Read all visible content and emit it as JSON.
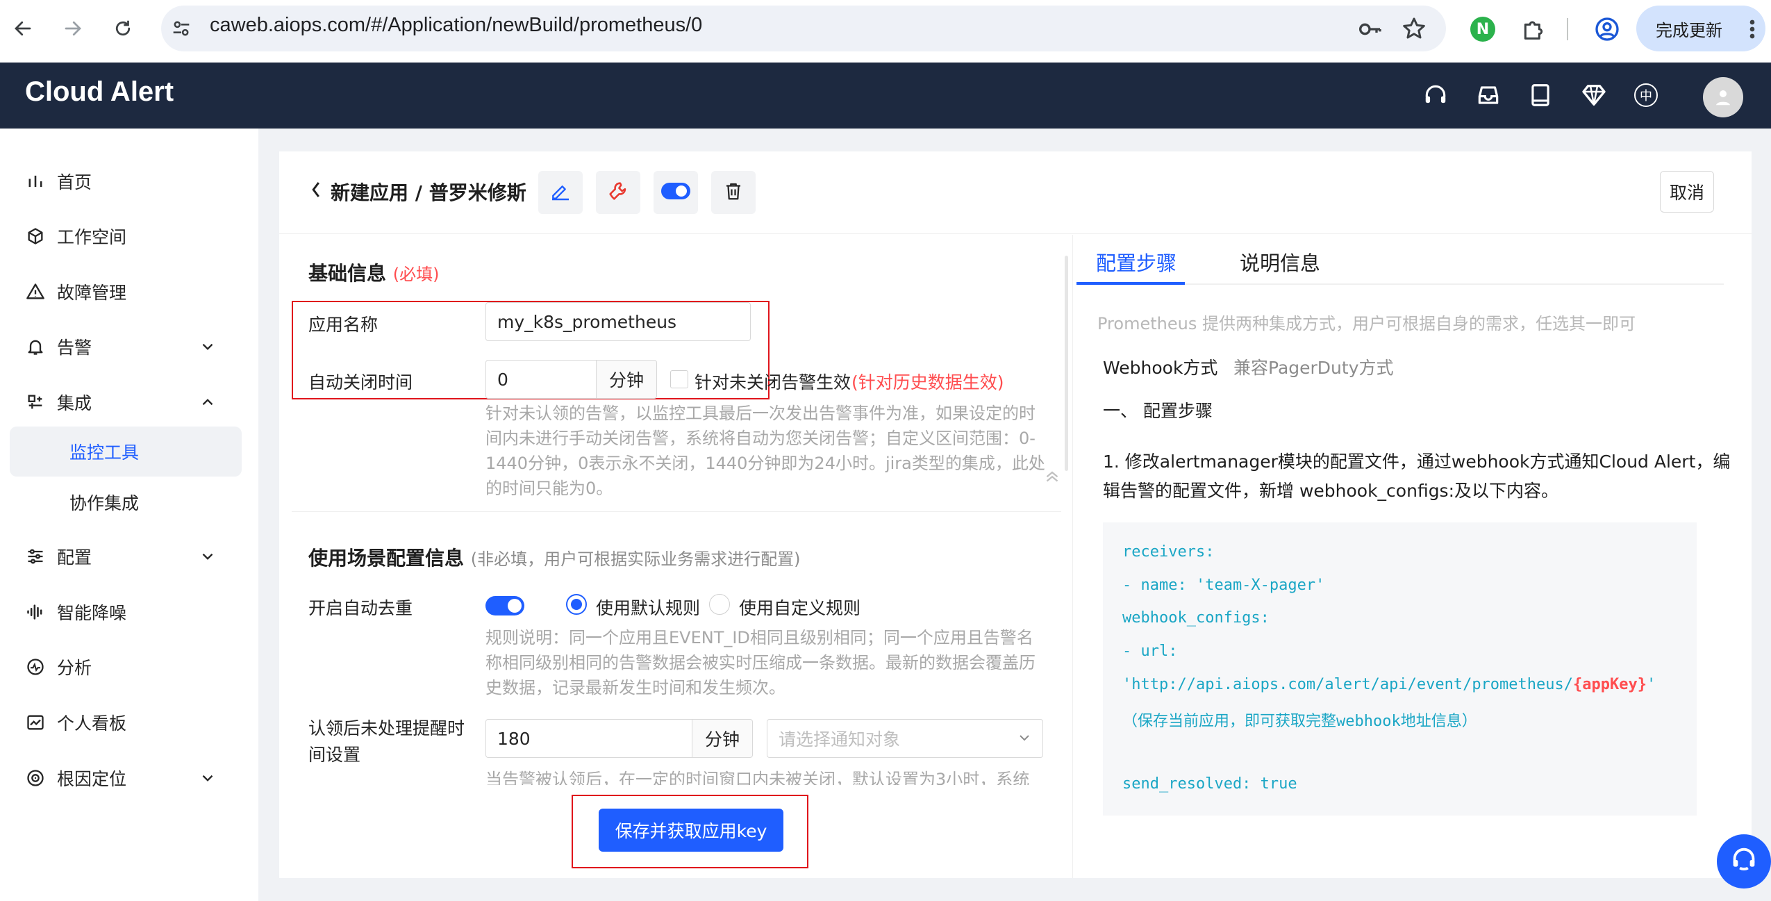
{
  "browser": {
    "url": "caweb.aiops.com/#/Application/newBuild/prometheus/0",
    "update_label": "完成更新",
    "icons": [
      "back-icon",
      "forward-icon",
      "reload-icon",
      "site-info-icon",
      "key-icon",
      "star-icon",
      "extension-n-icon",
      "puzzle-icon",
      "profile-icon",
      "more-icon"
    ]
  },
  "header": {
    "brand": "Cloud Alert",
    "icons": [
      "headset-icon",
      "inbox-icon",
      "book-icon",
      "diamond-icon",
      "language-icon",
      "avatar"
    ],
    "lang_glyph": "中"
  },
  "sidebar": {
    "items": [
      {
        "label": "首页",
        "icon": "bar-chart-icon"
      },
      {
        "label": "工作空间",
        "icon": "cube-icon"
      },
      {
        "label": "故障管理",
        "icon": "warning-icon"
      },
      {
        "label": "告警",
        "icon": "bell-icon"
      },
      {
        "label": "集成",
        "icon": "integration-icon"
      },
      {
        "label": "配置",
        "icon": "sliders-icon"
      },
      {
        "label": "智能降噪",
        "icon": "waveform-icon"
      },
      {
        "label": "分析",
        "icon": "analysis-icon"
      },
      {
        "label": "个人看板",
        "icon": "dashboard-icon"
      },
      {
        "label": "根因定位",
        "icon": "target-icon"
      }
    ],
    "sub_items": [
      {
        "label": "监控工具",
        "active": true
      },
      {
        "label": "协作集成",
        "active": false
      }
    ]
  },
  "page": {
    "title": "新建应用 / 普罗米修斯",
    "cancel": "取消"
  },
  "basic": {
    "title": "基础信息",
    "required": "(必填)",
    "app_name_label": "应用名称",
    "app_name_value": "my_k8s_prometheus",
    "auto_close_label": "自动关闭时间",
    "auto_close_value": "0",
    "minute_unit": "分钟",
    "unclosed_checkbox_label": "针对未关闭告警生效",
    "history_note": "(针对历史数据生效)",
    "help": [
      "针对未认领的告警，以监控工具最后一次发出告警事件为准，如果设定的时",
      "间内未进行手动关闭告警，系统将自动为您关闭告警；自定义区间范围：0-",
      "1440分钟，0表示永不关闭，1440分钟即为24小时。jira类型的集成，此处",
      "的时间只能为0。"
    ]
  },
  "scene": {
    "title": "使用场景配置信息",
    "subtitle": "(非必填，用户可根据实际业务需求进行配置)",
    "dedup_label": "开启自动去重",
    "dedup_on": true,
    "radio_default": "使用默认规则",
    "radio_custom": "使用自定义规则",
    "rule_help": [
      "规则说明：同一个应用且EVENT_ID相同且级别相同；同一个应用且告警名",
      "称相同级别相同的告警数据会被实时压缩成一条数据。最新的数据会覆盖历",
      "史数据，记录最新发生时间和发生频次。"
    ],
    "remind_label_1": "认领后未处理提醒时",
    "remind_label_2": "间设置",
    "remind_value": "180",
    "minute_unit": "分钟",
    "notify_placeholder": "请选择通知对象",
    "remind_help_partial": "当告警被认领后，在一定的时间窗口内未被关闭，默认设置为3小时，系统"
  },
  "save_button": "保存并获取应用key",
  "right": {
    "tabs": [
      {
        "label": "配置步骤",
        "active": true
      },
      {
        "label": "说明信息",
        "active": false
      }
    ],
    "intro": "Prometheus 提供两种集成方式，用户可根据自身的需求，任选其一即可",
    "methods": [
      {
        "label": "Webhook方式",
        "active": true
      },
      {
        "label": "兼容PagerDuty方式",
        "active": false
      }
    ],
    "step_heading": "一、 配置步骤",
    "step1_line1": "1. 修改alertmanager模块的配置文件，通过webhook方式通知Cloud Alert，编",
    "step1_line2": "辑告警的配置文件，新增 webhook_configs:及以下内容。",
    "code": {
      "l1": "receivers:",
      "l2": "- name: 'team-X-pager'",
      "l3": "webhook_configs:",
      "l4": "- url:",
      "l5_prefix": "'http://api.aiops.com/alert/api/event/prometheus/",
      "l5_key": "{appKey}",
      "l5_suffix": "'",
      "l6": "（保存当前应用，即可获取完整webhook地址信息）",
      "l8": "send_resolved: true"
    }
  },
  "colors": {
    "brand_bar": "#1d2940",
    "primary": "#1f5eff",
    "highlight_box": "#e0151c",
    "code_text": "#1aa6c5",
    "appkey": "#ff4d4f"
  }
}
